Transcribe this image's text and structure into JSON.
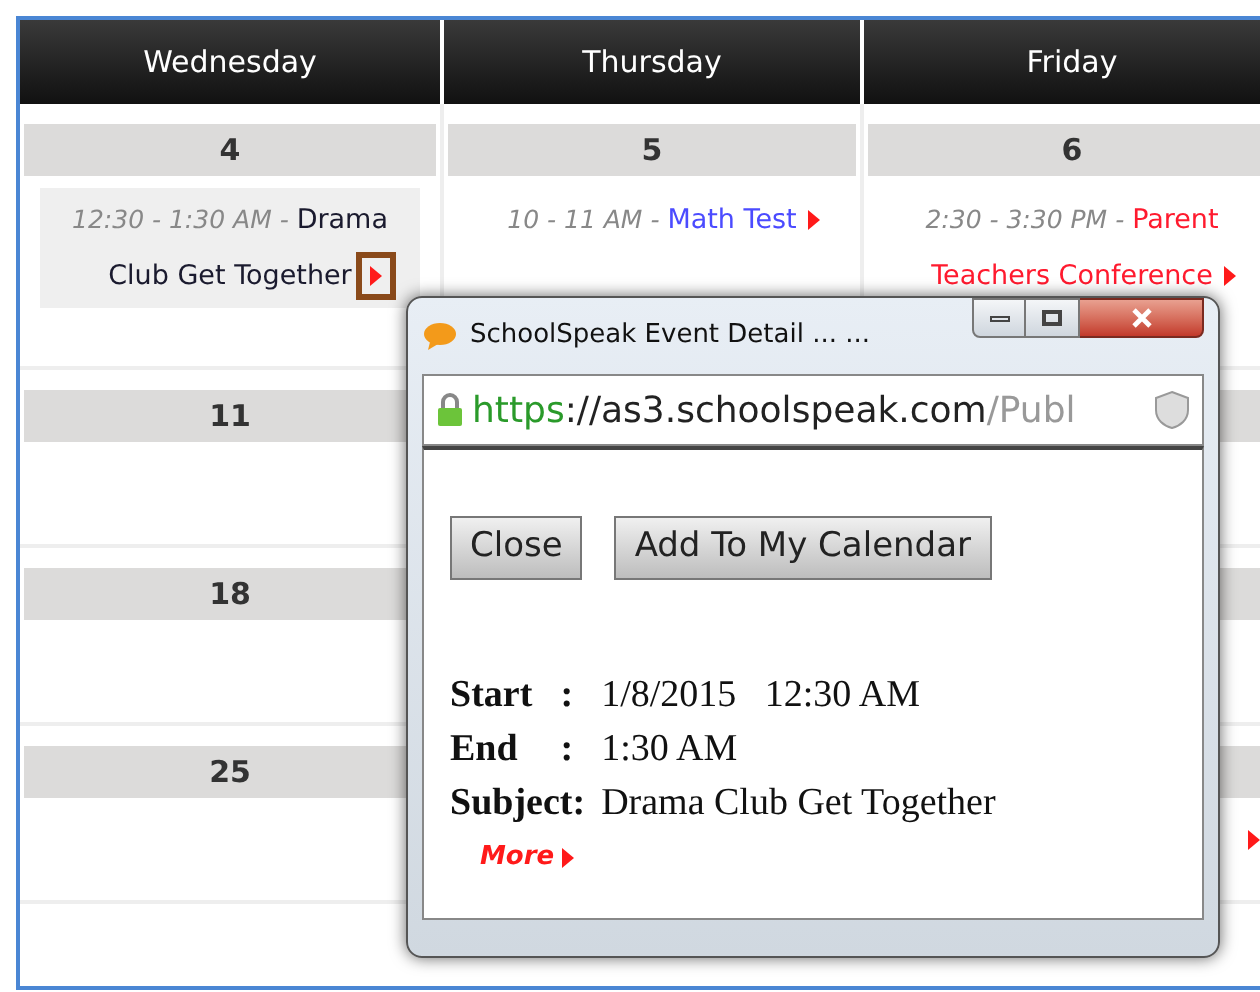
{
  "calendar": {
    "columns": [
      "Wednesday",
      "Thursday",
      "Friday"
    ],
    "weeks": [
      {
        "days": [
          {
            "date": "4",
            "events": [
              {
                "kind": "event",
                "time": "12:30 - 1:30 AM -",
                "title": "Drama Club Get Together",
                "color": "#1a1a2e",
                "highlighted": true
              }
            ]
          },
          {
            "date": "5",
            "events": [
              {
                "kind": "event",
                "time": "10 - 11 AM -",
                "title": "Math Test",
                "color": "#4b4bff",
                "highlighted": false
              }
            ]
          },
          {
            "date": "6",
            "events": [
              {
                "kind": "event",
                "time": "2:30 - 3:30 PM -",
                "title": "Parent Teachers Conference",
                "color": "#ff1a2e",
                "highlighted": false
              }
            ]
          }
        ]
      },
      {
        "days": [
          {
            "date": "11"
          }
        ]
      },
      {
        "days": [
          {
            "date": "18"
          }
        ]
      },
      {
        "days": [
          {
            "date": "25"
          }
        ],
        "friday": {
          "events": [
            {
              "kind": "arrow-only"
            }
          ]
        }
      }
    ]
  },
  "popup": {
    "title": "SchoolSpeak Event Detail ... ...",
    "url": {
      "scheme": "https",
      "host": "://as3.schoolspeak.com",
      "path": "/Publ"
    },
    "buttons": [
      "Close",
      "Add To My Calendar"
    ],
    "details": [
      {
        "label": "Start",
        "colon": ":",
        "value": "1/8/2015   12:30 AM"
      },
      {
        "label": "End",
        "colon": ":",
        "value": "1:30 AM"
      },
      {
        "label": "Subject:",
        "value": "Drama Club Get Together"
      }
    ],
    "more": "More"
  }
}
